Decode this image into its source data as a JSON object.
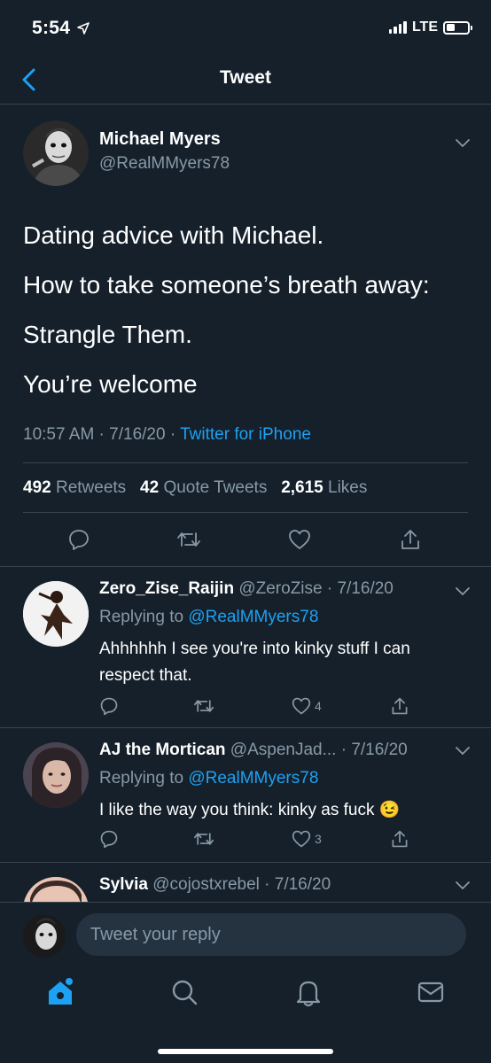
{
  "status_bar": {
    "time": "5:54",
    "network": "LTE",
    "battery_level": 0.4
  },
  "nav": {
    "title": "Tweet"
  },
  "main_tweet": {
    "name": "Michael Myers",
    "handle": "@RealMMyers78",
    "text_lines": [
      "Dating advice with Michael.",
      "How to take someone’s breath away:",
      "Strangle Them.",
      "You’re welcome"
    ],
    "time": "10:57 AM · 7/16/20 · ",
    "source": "Twitter for iPhone",
    "retweets_count": "492",
    "retweets_label": " Retweets  ",
    "quotes_count": "42",
    "quotes_label": " Quote Tweets  ",
    "likes_count": "2,615",
    "likes_label": " Likes"
  },
  "replies": [
    {
      "name": "Zero_Zise_Raijin",
      "meta": " @ZeroZise · 7/16/20",
      "replying_prefix": "Replying to ",
      "replying_to": "@RealMMyers78",
      "text": "Ahhhhhh I see you're into kinky stuff I can respect that.",
      "likes": "4"
    },
    {
      "name": "AJ the Mortican",
      "meta": " @AspenJad... · 7/16/20",
      "replying_prefix": "Replying to ",
      "replying_to": "@RealMMyers78",
      "text": "I like the way you think: kinky as fuck 😉",
      "likes": "3"
    },
    {
      "name": "Sylvia",
      "meta": " @cojostxrebel · 7/16/20"
    }
  ],
  "compose": {
    "placeholder": "Tweet your reply"
  },
  "colors": {
    "background": "#15202b",
    "accent": "#1da1f2",
    "secondary_text": "#8899a6",
    "divider": "#38444d"
  },
  "icons": {
    "tabs": [
      "home-icon",
      "search-icon",
      "notifications-icon",
      "messages-icon"
    ],
    "actions": [
      "reply-icon",
      "retweet-icon",
      "like-icon",
      "share-icon"
    ]
  }
}
